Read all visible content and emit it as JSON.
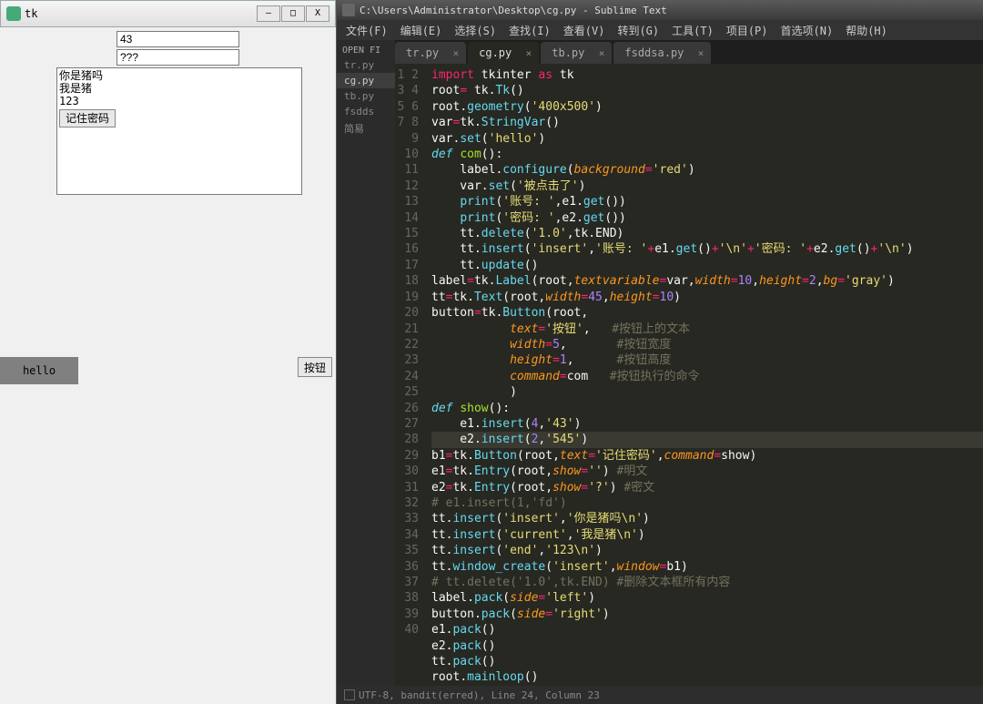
{
  "tk": {
    "title": "tk",
    "win_btns": {
      "min": "—",
      "max": "□",
      "close": "X"
    },
    "entry1": "43",
    "entry2": "???",
    "text_lines": [
      "你是猪吗",
      "我是猪",
      "123"
    ],
    "b1_label": "记住密码",
    "label_text": "hello",
    "button_text": "按钮"
  },
  "sublime": {
    "title": "C:\\Users\\Administrator\\Desktop\\cg.py - Sublime Text",
    "menu": [
      "文件(F)",
      "编辑(E)",
      "选择(S)",
      "查找(I)",
      "查看(V)",
      "转到(G)",
      "工具(T)",
      "项目(P)",
      "首选项(N)",
      "帮助(H)"
    ],
    "sidebar_header": "OPEN FI",
    "sidebar_files": [
      {
        "name": "tr.py",
        "active": false
      },
      {
        "name": "cg.py",
        "active": true
      },
      {
        "name": "tb.py",
        "active": false
      },
      {
        "name": "fsdds",
        "active": false
      },
      {
        "name": "简易",
        "active": false
      }
    ],
    "tabs": [
      {
        "label": "tr.py",
        "active": false
      },
      {
        "label": "cg.py",
        "active": true
      },
      {
        "label": "tb.py",
        "active": false
      },
      {
        "label": "fsddsa.py",
        "active": false
      }
    ],
    "line_count": 40,
    "highlight_line": 24,
    "status": "UTF-8, bandit(erred), Line 24, Column 23",
    "code": [
      [
        [
          "kw",
          "import"
        ],
        [
          "pl",
          " tkinter "
        ],
        [
          "kw",
          "as"
        ],
        [
          "pl",
          " tk"
        ]
      ],
      [
        [
          "pl",
          "root"
        ],
        [
          "op",
          "= "
        ],
        [
          "pl",
          "tk"
        ],
        [
          "pl",
          "."
        ],
        [
          "fn",
          "Tk"
        ],
        [
          "pl",
          "()"
        ]
      ],
      [
        [
          "pl",
          "root"
        ],
        [
          "pl",
          "."
        ],
        [
          "fn",
          "geometry"
        ],
        [
          "pl",
          "("
        ],
        [
          "str",
          "'400x500'"
        ],
        [
          "pl",
          ")"
        ]
      ],
      [
        [
          "pl",
          "var"
        ],
        [
          "op",
          "="
        ],
        [
          "pl",
          "tk"
        ],
        [
          "pl",
          "."
        ],
        [
          "fn",
          "StringVar"
        ],
        [
          "pl",
          "()"
        ]
      ],
      [
        [
          "pl",
          "var"
        ],
        [
          "pl",
          "."
        ],
        [
          "fn",
          "set"
        ],
        [
          "pl",
          "("
        ],
        [
          "str",
          "'hello'"
        ],
        [
          "pl",
          ")"
        ]
      ],
      [
        [
          "kw2",
          "def"
        ],
        [
          "pl",
          " "
        ],
        [
          "nm",
          "com"
        ],
        [
          "pl",
          "():"
        ]
      ],
      [
        [
          "pl",
          "    label"
        ],
        [
          "pl",
          "."
        ],
        [
          "fn",
          "configure"
        ],
        [
          "pl",
          "("
        ],
        [
          "arg",
          "background"
        ],
        [
          "op",
          "="
        ],
        [
          "str",
          "'red'"
        ],
        [
          "pl",
          ")"
        ]
      ],
      [
        [
          "pl",
          "    var"
        ],
        [
          "pl",
          "."
        ],
        [
          "fn",
          "set"
        ],
        [
          "pl",
          "("
        ],
        [
          "str",
          "'被点击了'"
        ],
        [
          "pl",
          ")"
        ]
      ],
      [
        [
          "pl",
          "    "
        ],
        [
          "fn",
          "print"
        ],
        [
          "pl",
          "("
        ],
        [
          "str",
          "'账号: '"
        ],
        [
          "pl",
          ",e1"
        ],
        [
          "pl",
          "."
        ],
        [
          "fn",
          "get"
        ],
        [
          "pl",
          "())"
        ]
      ],
      [
        [
          "pl",
          "    "
        ],
        [
          "fn",
          "print"
        ],
        [
          "pl",
          "("
        ],
        [
          "str",
          "'密码: '"
        ],
        [
          "pl",
          ",e2"
        ],
        [
          "pl",
          "."
        ],
        [
          "fn",
          "get"
        ],
        [
          "pl",
          "())"
        ]
      ],
      [
        [
          "pl",
          "    tt"
        ],
        [
          "pl",
          "."
        ],
        [
          "fn",
          "delete"
        ],
        [
          "pl",
          "("
        ],
        [
          "str",
          "'1.0'"
        ],
        [
          "pl",
          ",tk"
        ],
        [
          "pl",
          ".END)"
        ]
      ],
      [
        [
          "pl",
          "    tt"
        ],
        [
          "pl",
          "."
        ],
        [
          "fn",
          "insert"
        ],
        [
          "pl",
          "("
        ],
        [
          "str",
          "'insert'"
        ],
        [
          "pl",
          ","
        ],
        [
          "str",
          "'账号: '"
        ],
        [
          "op",
          "+"
        ],
        [
          "pl",
          "e1"
        ],
        [
          "pl",
          "."
        ],
        [
          "fn",
          "get"
        ],
        [
          "pl",
          "()"
        ],
        [
          "op",
          "+"
        ],
        [
          "str",
          "'\\n'"
        ],
        [
          "op",
          "+"
        ],
        [
          "str",
          "'密码: '"
        ],
        [
          "op",
          "+"
        ],
        [
          "pl",
          "e2"
        ],
        [
          "pl",
          "."
        ],
        [
          "fn",
          "get"
        ],
        [
          "pl",
          "()"
        ],
        [
          "op",
          "+"
        ],
        [
          "str",
          "'\\n'"
        ],
        [
          "pl",
          ")"
        ]
      ],
      [
        [
          "pl",
          "    tt"
        ],
        [
          "pl",
          "."
        ],
        [
          "fn",
          "update"
        ],
        [
          "pl",
          "()"
        ]
      ],
      [
        [
          "pl",
          "label"
        ],
        [
          "op",
          "="
        ],
        [
          "pl",
          "tk"
        ],
        [
          "pl",
          "."
        ],
        [
          "fn",
          "Label"
        ],
        [
          "pl",
          "(root,"
        ],
        [
          "arg",
          "textvariable"
        ],
        [
          "op",
          "="
        ],
        [
          "pl",
          "var,"
        ],
        [
          "arg",
          "width"
        ],
        [
          "op",
          "="
        ],
        [
          "num",
          "10"
        ],
        [
          "pl",
          ","
        ],
        [
          "arg",
          "height"
        ],
        [
          "op",
          "="
        ],
        [
          "num",
          "2"
        ],
        [
          "pl",
          ","
        ],
        [
          "arg",
          "bg"
        ],
        [
          "op",
          "="
        ],
        [
          "str",
          "'gray'"
        ],
        [
          "pl",
          ")"
        ]
      ],
      [
        [
          "pl",
          "tt"
        ],
        [
          "op",
          "="
        ],
        [
          "pl",
          "tk"
        ],
        [
          "pl",
          "."
        ],
        [
          "fn",
          "Text"
        ],
        [
          "pl",
          "(root,"
        ],
        [
          "arg",
          "width"
        ],
        [
          "op",
          "="
        ],
        [
          "num",
          "45"
        ],
        [
          "pl",
          ","
        ],
        [
          "arg",
          "height"
        ],
        [
          "op",
          "="
        ],
        [
          "num",
          "10"
        ],
        [
          "pl",
          ")"
        ]
      ],
      [
        [
          "pl",
          "button"
        ],
        [
          "op",
          "="
        ],
        [
          "pl",
          "tk"
        ],
        [
          "pl",
          "."
        ],
        [
          "fn",
          "Button"
        ],
        [
          "pl",
          "(root,"
        ]
      ],
      [
        [
          "pl",
          "           "
        ],
        [
          "arg",
          "text"
        ],
        [
          "op",
          "="
        ],
        [
          "str",
          "'按钮'"
        ],
        [
          "pl",
          ",   "
        ],
        [
          "cm",
          "#按钮上的文本"
        ]
      ],
      [
        [
          "pl",
          "           "
        ],
        [
          "arg",
          "width"
        ],
        [
          "op",
          "="
        ],
        [
          "num",
          "5"
        ],
        [
          "pl",
          ",       "
        ],
        [
          "cm",
          "#按钮宽度"
        ]
      ],
      [
        [
          "pl",
          "           "
        ],
        [
          "arg",
          "height"
        ],
        [
          "op",
          "="
        ],
        [
          "num",
          "1"
        ],
        [
          "pl",
          ",      "
        ],
        [
          "cm",
          "#按钮高度"
        ]
      ],
      [
        [
          "pl",
          "           "
        ],
        [
          "arg",
          "command"
        ],
        [
          "op",
          "="
        ],
        [
          "pl",
          "com   "
        ],
        [
          "cm",
          "#按钮执行的命令"
        ]
      ],
      [
        [
          "pl",
          "           )"
        ]
      ],
      [
        [
          "kw2",
          "def"
        ],
        [
          "pl",
          " "
        ],
        [
          "nm",
          "show"
        ],
        [
          "pl",
          "():"
        ]
      ],
      [
        [
          "pl",
          "    e1"
        ],
        [
          "pl",
          "."
        ],
        [
          "fn",
          "insert"
        ],
        [
          "pl",
          "("
        ],
        [
          "num",
          "4"
        ],
        [
          "pl",
          ","
        ],
        [
          "str",
          "'43'"
        ],
        [
          "pl",
          ")"
        ]
      ],
      [
        [
          "pl",
          "    e2"
        ],
        [
          "pl",
          "."
        ],
        [
          "fn",
          "insert"
        ],
        [
          "pl",
          "("
        ],
        [
          "num",
          "2"
        ],
        [
          "pl",
          ","
        ],
        [
          "str",
          "'545'"
        ],
        [
          "pl",
          ")"
        ]
      ],
      [
        [
          "pl",
          "b1"
        ],
        [
          "op",
          "="
        ],
        [
          "pl",
          "tk"
        ],
        [
          "pl",
          "."
        ],
        [
          "fn",
          "Button"
        ],
        [
          "pl",
          "(root,"
        ],
        [
          "arg",
          "text"
        ],
        [
          "op",
          "="
        ],
        [
          "str",
          "'记住密码'"
        ],
        [
          "pl",
          ","
        ],
        [
          "arg",
          "command"
        ],
        [
          "op",
          "="
        ],
        [
          "pl",
          "show)"
        ]
      ],
      [
        [
          "pl",
          "e1"
        ],
        [
          "op",
          "="
        ],
        [
          "pl",
          "tk"
        ],
        [
          "pl",
          "."
        ],
        [
          "fn",
          "Entry"
        ],
        [
          "pl",
          "(root,"
        ],
        [
          "arg",
          "show"
        ],
        [
          "op",
          "="
        ],
        [
          "str",
          "''"
        ],
        [
          "pl",
          ") "
        ],
        [
          "cm",
          "#明文"
        ]
      ],
      [
        [
          "pl",
          "e2"
        ],
        [
          "op",
          "="
        ],
        [
          "pl",
          "tk"
        ],
        [
          "pl",
          "."
        ],
        [
          "fn",
          "Entry"
        ],
        [
          "pl",
          "(root,"
        ],
        [
          "arg",
          "show"
        ],
        [
          "op",
          "="
        ],
        [
          "str",
          "'?'"
        ],
        [
          "pl",
          ") "
        ],
        [
          "cm",
          "#密文"
        ]
      ],
      [
        [
          "cm",
          "# e1.insert(1,'fd')"
        ]
      ],
      [
        [
          "pl",
          "tt"
        ],
        [
          "pl",
          "."
        ],
        [
          "fn",
          "insert"
        ],
        [
          "pl",
          "("
        ],
        [
          "str",
          "'insert'"
        ],
        [
          "pl",
          ","
        ],
        [
          "str",
          "'你是猪吗\\n'"
        ],
        [
          "pl",
          ")"
        ]
      ],
      [
        [
          "pl",
          "tt"
        ],
        [
          "pl",
          "."
        ],
        [
          "fn",
          "insert"
        ],
        [
          "pl",
          "("
        ],
        [
          "str",
          "'current'"
        ],
        [
          "pl",
          ","
        ],
        [
          "str",
          "'我是猪\\n'"
        ],
        [
          "pl",
          ")"
        ]
      ],
      [
        [
          "pl",
          "tt"
        ],
        [
          "pl",
          "."
        ],
        [
          "fn",
          "insert"
        ],
        [
          "pl",
          "("
        ],
        [
          "str",
          "'end'"
        ],
        [
          "pl",
          ","
        ],
        [
          "str",
          "'123\\n'"
        ],
        [
          "pl",
          ")"
        ]
      ],
      [
        [
          "pl",
          "tt"
        ],
        [
          "pl",
          "."
        ],
        [
          "fn",
          "window_create"
        ],
        [
          "pl",
          "("
        ],
        [
          "str",
          "'insert'"
        ],
        [
          "pl",
          ","
        ],
        [
          "arg",
          "window"
        ],
        [
          "op",
          "="
        ],
        [
          "pl",
          "b1)"
        ]
      ],
      [
        [
          "cm",
          "# tt.delete('1.0',tk.END) #删除文本框所有内容"
        ]
      ],
      [
        [
          "pl",
          "label"
        ],
        [
          "pl",
          "."
        ],
        [
          "fn",
          "pack"
        ],
        [
          "pl",
          "("
        ],
        [
          "arg",
          "side"
        ],
        [
          "op",
          "="
        ],
        [
          "str",
          "'left'"
        ],
        [
          "pl",
          ")"
        ]
      ],
      [
        [
          "pl",
          "button"
        ],
        [
          "pl",
          "."
        ],
        [
          "fn",
          "pack"
        ],
        [
          "pl",
          "("
        ],
        [
          "arg",
          "side"
        ],
        [
          "op",
          "="
        ],
        [
          "str",
          "'right'"
        ],
        [
          "pl",
          ")"
        ]
      ],
      [
        [
          "pl",
          "e1"
        ],
        [
          "pl",
          "."
        ],
        [
          "fn",
          "pack"
        ],
        [
          "pl",
          "()"
        ]
      ],
      [
        [
          "pl",
          "e2"
        ],
        [
          "pl",
          "."
        ],
        [
          "fn",
          "pack"
        ],
        [
          "pl",
          "()"
        ]
      ],
      [
        [
          "pl",
          "tt"
        ],
        [
          "pl",
          "."
        ],
        [
          "fn",
          "pack"
        ],
        [
          "pl",
          "()"
        ]
      ],
      [
        [
          "pl",
          "root"
        ],
        [
          "pl",
          "."
        ],
        [
          "fn",
          "mainloop"
        ],
        [
          "pl",
          "()"
        ]
      ],
      [
        [
          "pl",
          " "
        ]
      ]
    ]
  }
}
